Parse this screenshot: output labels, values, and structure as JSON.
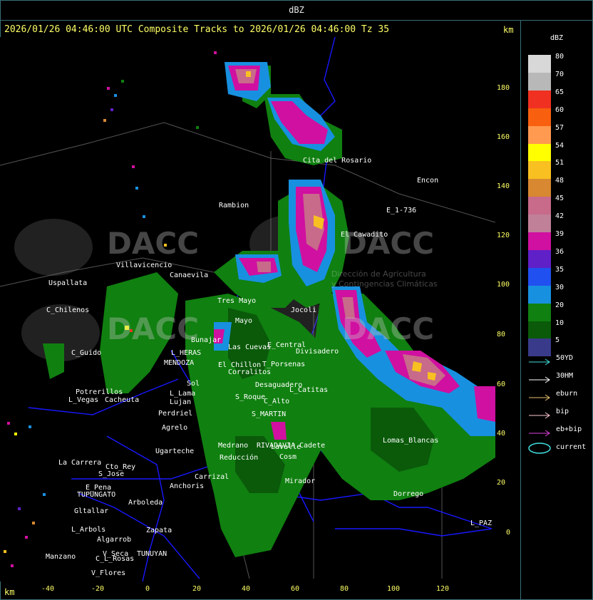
{
  "window": {
    "title": "dBZ"
  },
  "header": {
    "caption": "2026/01/26 04:46:00 UTC Composite Tracks to 2026/01/26 04:46:00 Tz 35",
    "km_top": "km",
    "km_bottom": "km"
  },
  "axes": {
    "y_ticks": [
      "180",
      "160",
      "140",
      "120",
      "100",
      "80",
      "60",
      "40",
      "20",
      "0"
    ],
    "x_ticks": [
      "-40",
      "-20",
      "0",
      "20",
      "40",
      "60",
      "80",
      "100",
      "120"
    ]
  },
  "legend": {
    "title": "dBZ",
    "levels": [
      {
        "label": "80",
        "color": "#d8d8d8"
      },
      {
        "label": "70",
        "color": "#b8b8b8"
      },
      {
        "label": "65",
        "color": "#f03020"
      },
      {
        "label": "60",
        "color": "#f86010"
      },
      {
        "label": "57",
        "color": "#ff9a50"
      },
      {
        "label": "54",
        "color": "#ffff00"
      },
      {
        "label": "51",
        "color": "#f8c020"
      },
      {
        "label": "48",
        "color": "#d88830"
      },
      {
        "label": "45",
        "color": "#c86a8a"
      },
      {
        "label": "42",
        "color": "#c08098"
      },
      {
        "label": "39",
        "color": "#d010a0"
      },
      {
        "label": "36",
        "color": "#6020c8"
      },
      {
        "label": "35",
        "color": "#2050f0"
      },
      {
        "label": "30",
        "color": "#1890e0"
      },
      {
        "label": "20",
        "color": "#108010"
      },
      {
        "label": "10",
        "color": "#0a5a0a"
      },
      {
        "label": "5",
        "color": "#3a3a8a"
      }
    ],
    "tracks": [
      {
        "label": "50YD",
        "color": "#40e0e0",
        "icon": "arrow-icon"
      },
      {
        "label": "30HM",
        "color": "#ffffff",
        "icon": "arrow-icon"
      },
      {
        "label": "eburn",
        "color": "#e8c070",
        "icon": "arrow-icon"
      },
      {
        "label": "bip",
        "color": "#ffc8d0",
        "icon": "arrow-icon"
      },
      {
        "label": "eb+bip",
        "color": "#e040e0",
        "icon": "arrow-icon"
      },
      {
        "label": "current",
        "color": "#40e0e0",
        "icon": "ellipse-icon"
      }
    ]
  },
  "places": [
    "Cita del Rosario",
    "Rambion",
    "E_1-736",
    "El Cawadito",
    "Encon",
    "Villavicencio",
    "Canaevila",
    "Uspallata",
    "C_Chilenos",
    "Tres Mayo",
    "Jocoli",
    "Las Cuevas",
    "Bunajar",
    "C_Guido",
    "L_HERAS",
    "MENDOZA",
    "Divisadero",
    "T_Porsenas",
    "Potrerillos",
    "L_Vegas",
    "Cacheuta",
    "Lujan",
    "Perdriel",
    "Agrelo",
    "Ugarteche",
    "La Carrera",
    "S_Jose",
    "Cto_Rey",
    "E_Pena",
    "TUPUNGATO",
    "Anchoris",
    "Arboleda",
    "Gltallar",
    "Zapata",
    "L_Arbols",
    "Algarrob",
    "Manzano",
    "TUNUYAN",
    "V_Flores",
    "C_L_Rosas",
    "Lomas_Blancas",
    "Dorrego",
    "L_PAZ",
    "RIVADAVIA",
    "Carrizal",
    "Mirador",
    "S_MARTIN",
    "Lavalle",
    "Cadete",
    "Medrano",
    "Cosm",
    "Corralitos",
    "El Chillon",
    "V_Seca",
    "L_Lama",
    "Sol",
    "Reducción",
    "C_Alto",
    "Desaguadero",
    "L_Catitas",
    "S_Roque",
    "E_Central",
    "Mayo"
  ],
  "watermark": {
    "logo_text": "DACC",
    "org_line1": "Dirección de Agricultura",
    "org_line2": "y Contingencias Climáticas"
  },
  "colors": {
    "frame": "#3a6f7a",
    "axis_text": "#ffff66",
    "roads": "#1818ff",
    "borders": "#555555"
  }
}
